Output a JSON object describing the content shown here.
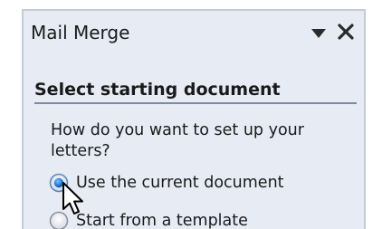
{
  "pane": {
    "title": "Mail Merge",
    "menu_icon": "chevron-down-icon",
    "close_icon": "close-icon",
    "section_heading": "Select starting document",
    "question": "How do you want to set up your letters?",
    "options": [
      {
        "label": "Use the current document",
        "selected": true
      },
      {
        "label": "Start from a template",
        "selected": false
      }
    ]
  },
  "colors": {
    "pane_background": "#e7ebf4",
    "pane_border": "#c3cad8",
    "radio_selected": "#2c7fd6"
  }
}
